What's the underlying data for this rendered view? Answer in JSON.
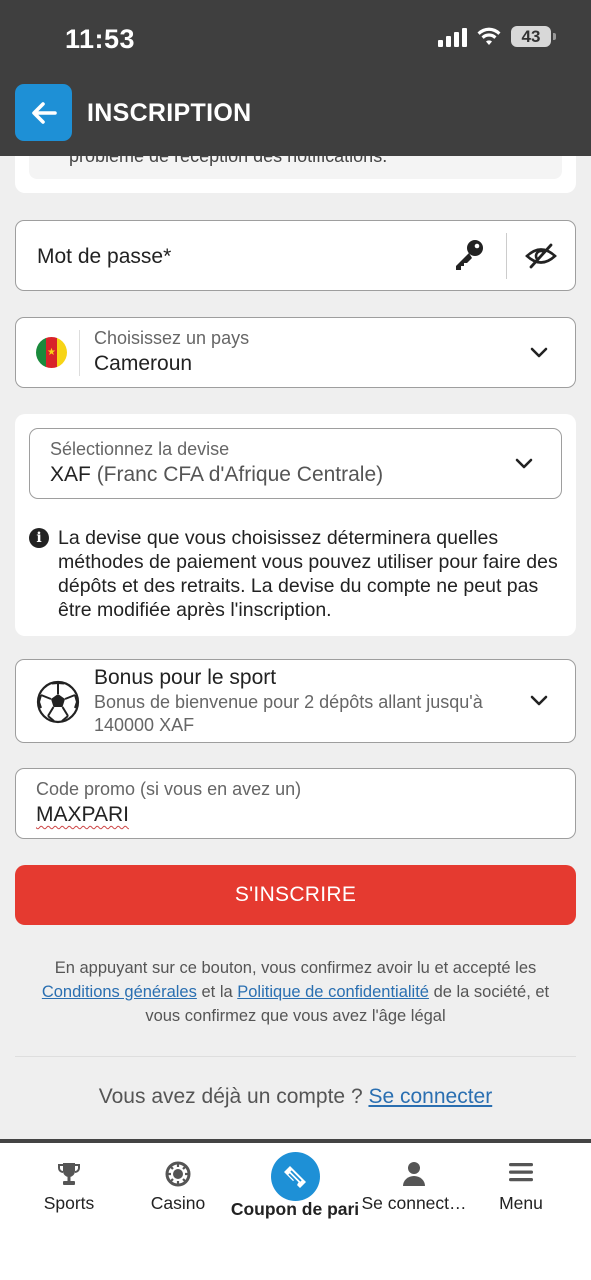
{
  "status_bar": {
    "time": "11:53",
    "battery": "43"
  },
  "header": {
    "title": "INSCRIPTION"
  },
  "notice_partial": "problème de réception des notifications.",
  "password": {
    "placeholder": "Mot de passe*"
  },
  "country": {
    "label": "Choisissez un pays",
    "value": "Cameroun"
  },
  "currency": {
    "label": "Sélectionnez la devise",
    "code": "XAF",
    "name": "(Franc CFA d'Afrique Centrale)",
    "info": "La devise que vous choisissez déterminera quelles méthodes de paiement vous pouvez utiliser pour faire des dépôts et des retraits. La devise du compte ne peut pas être modifiée après l'inscription."
  },
  "bonus": {
    "title": "Bonus pour le sport",
    "description_line1": "Bonus de bienvenue pour 2 dépôts allant jusqu'à",
    "description_line2": "140000 XAF"
  },
  "promo": {
    "label": "Code promo (si vous en avez un)",
    "value": "MAXPARI"
  },
  "submit_label": "S'INSCRIRE",
  "legal": {
    "line1": "En appuyant sur ce bouton, vous confirmez avoir lu et accepté les",
    "terms_link": "Conditions générales",
    "and": "et la",
    "privacy_link": "Politique de confidentialité",
    "line2_end": "de la société, et",
    "line3": "vous confirmez que vous avez l'âge légal"
  },
  "login": {
    "question": "Vous avez déjà un compte ?",
    "link": "Se connecter"
  },
  "nav": {
    "sports": "Sports",
    "casino": "Casino",
    "coupon": "Coupon de pari",
    "login": "Se connect…",
    "menu": "Menu"
  },
  "colors": {
    "header_bg": "#3f3f3f",
    "accent_blue": "#1e90d6",
    "submit_red": "#e53a30",
    "link_blue": "#2a6fb1"
  },
  "flag_colors": [
    "#1a8a3c",
    "#d8232a",
    "#f7d416"
  ]
}
